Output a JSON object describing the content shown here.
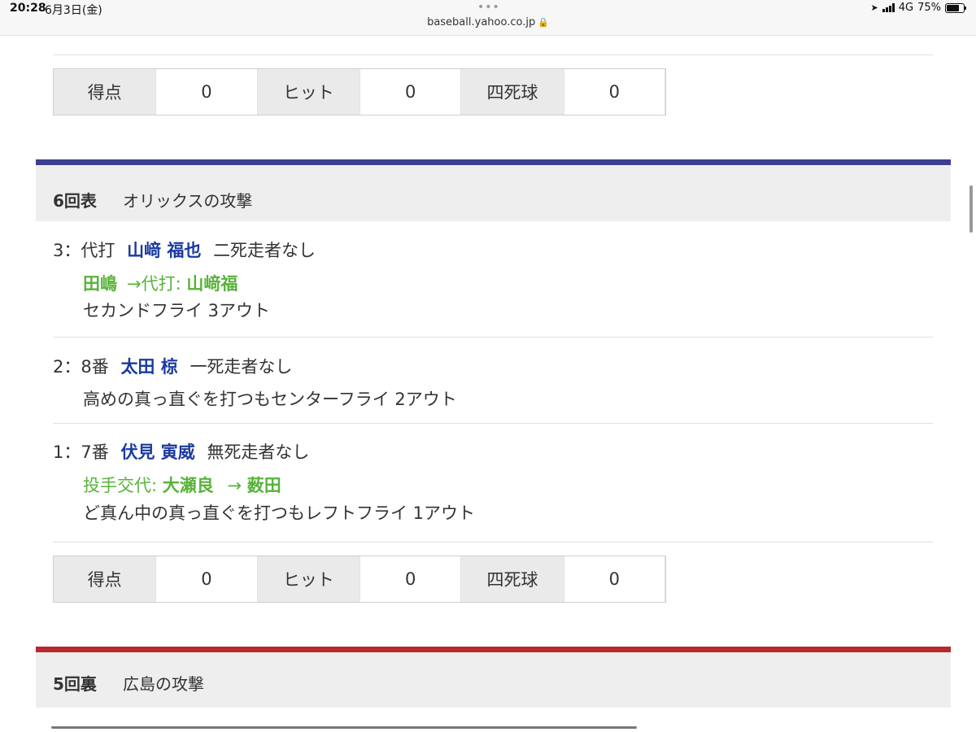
{
  "status_bar": {
    "time": "20:28",
    "date": "6月3日(金)",
    "url": "baseball.yahoo.co.jp",
    "network": "4G",
    "battery": "75%"
  },
  "top_stats": {
    "score_label": "得点",
    "score": "0",
    "hits_label": "ヒット",
    "hits": "0",
    "walks_label": "四死球",
    "walks": "0"
  },
  "inning_6_top": {
    "inning": "6回表",
    "team_attack": "オリックスの攻撃",
    "bar_color": "#3a3f8f",
    "plays": [
      {
        "seq": "3",
        "order": "代打",
        "player": "山﨑 福也",
        "situation": "二死走者なし",
        "sub_player": "田嶋",
        "sub_arrow": "→代打: ",
        "sub_to": "山﨑福",
        "result": "セカンドフライ 3アウト"
      },
      {
        "seq": "2",
        "order": "8番",
        "player": "太田 椋",
        "situation": "一死走者なし",
        "result": "高めの真っ直ぐを打つもセンターフライ 2アウト"
      },
      {
        "seq": "1",
        "order": "7番",
        "player": "伏見 寅威",
        "situation": "無死走者なし",
        "change_label": "投手交代: ",
        "change_from": "大瀬良",
        "change_arrow": " → ",
        "change_to": "薮田",
        "result": "ど真ん中の真っ直ぐを打つもレフトフライ 1アウト"
      }
    ],
    "stats": {
      "score_label": "得点",
      "score": "0",
      "hits_label": "ヒット",
      "hits": "0",
      "walks_label": "四死球",
      "walks": "0"
    }
  },
  "inning_5_bottom": {
    "inning": "5回裏",
    "team_attack": "広島の攻撃",
    "bar_color": "#b8282e"
  }
}
